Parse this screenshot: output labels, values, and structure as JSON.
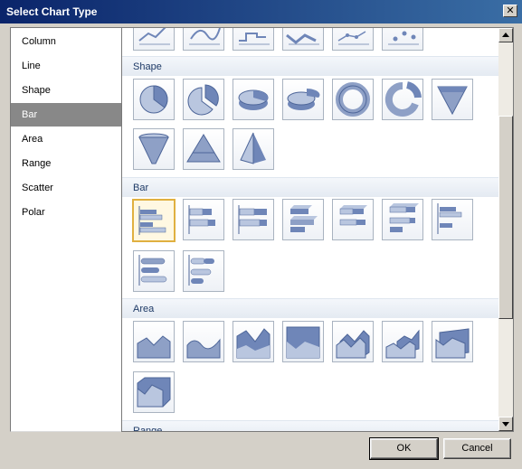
{
  "window": {
    "title": "Select Chart Type",
    "close_glyph": "✕"
  },
  "types": [
    {
      "label": "Column"
    },
    {
      "label": "Line"
    },
    {
      "label": "Shape"
    },
    {
      "label": "Bar",
      "selected": true
    },
    {
      "label": "Area"
    },
    {
      "label": "Range"
    },
    {
      "label": "Scatter"
    },
    {
      "label": "Polar"
    }
  ],
  "gallery": {
    "sections": [
      {
        "label": "Shape"
      },
      {
        "label": "Bar"
      },
      {
        "label": "Area"
      },
      {
        "label": "Range"
      }
    ],
    "top_partial_icons": [
      "line-chart-icon",
      "smooth-line-icon",
      "step-line-icon",
      "3d-line-icon",
      "line-markers-icon",
      "line-points-icon"
    ],
    "shape_icons": [
      "pie-icon",
      "exploded-pie-icon",
      "3d-pie-icon",
      "3d-exploded-pie-icon",
      "doughnut-icon",
      "exploded-doughnut-icon",
      "funnel-icon",
      "3d-funnel-icon",
      "pyramid-icon",
      "3d-pyramid-icon"
    ],
    "bar_icons": [
      "bar-icon",
      "stacked-bar-icon",
      "100-stacked-bar-icon",
      "3d-bar-icon",
      "3d-stacked-bar-icon",
      "3d-100-stacked-bar-icon",
      "3d-clustered-bar-icon",
      "cylinder-bar-icon",
      "3d-cylinder-stacked-bar-icon"
    ],
    "area_icons": [
      "area-icon",
      "smooth-area-icon",
      "stacked-area-icon",
      "100-stacked-area-icon",
      "3d-area-icon",
      "3d-stacked-area-icon",
      "3d-100-stacked-area-icon",
      "3d-area-box-icon"
    ],
    "selected_icon": "bar-icon"
  },
  "buttons": {
    "ok": "OK",
    "cancel": "Cancel"
  },
  "colors": {
    "title_start": "#0a246a",
    "title_end": "#3a6ea5",
    "selection": "#888888",
    "section_text": "#1e3a66",
    "icon_fill": "#6f86b8"
  }
}
